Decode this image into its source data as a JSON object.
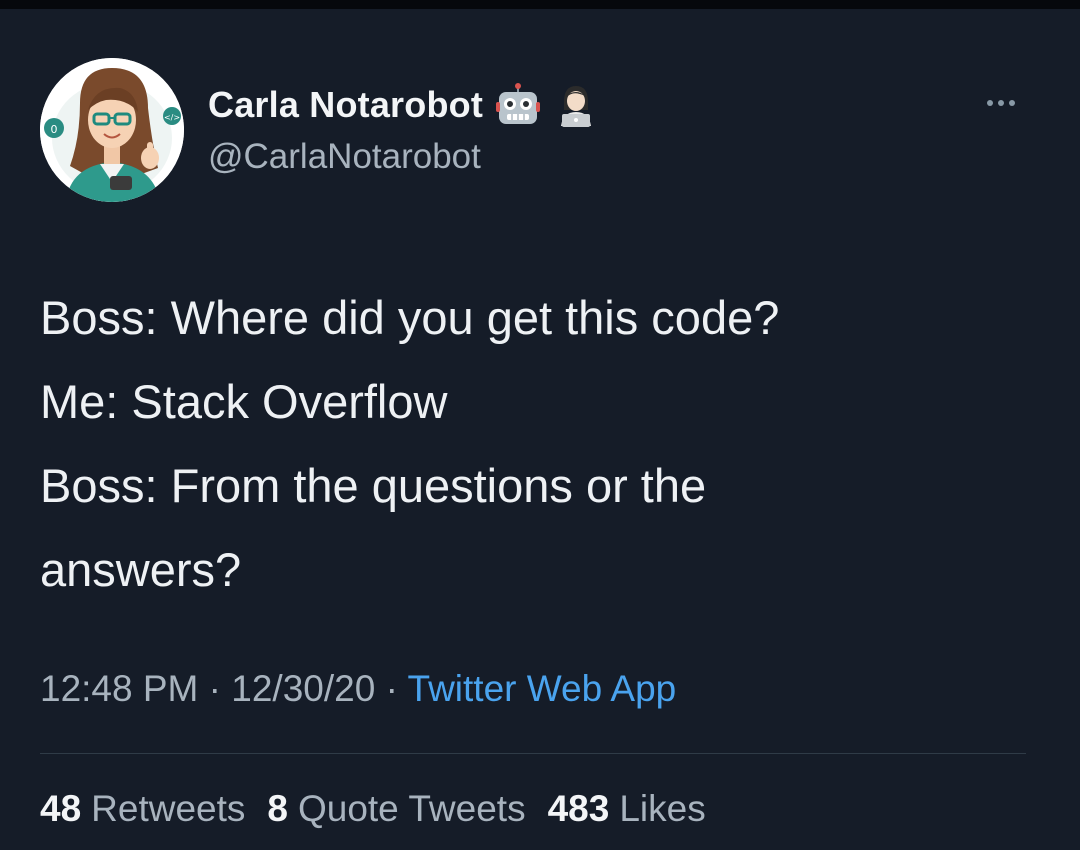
{
  "tweet": {
    "author": {
      "display_name": "Carla Notarobot",
      "handle": "@CarlaNotarobot",
      "name_emojis": [
        "robot-face-icon",
        "woman-technologist-icon"
      ]
    },
    "text_lines": [
      "Boss: Where did you get this code?",
      "Me: Stack Overflow",
      "Boss: From the questions or the",
      "answers?"
    ],
    "time": "12:48 PM",
    "date": "12/30/20",
    "separator": "·",
    "source": "Twitter Web App",
    "stats": {
      "retweets": {
        "count": "48",
        "label": "Retweets"
      },
      "quote_tweets": {
        "count": "8",
        "label": "Quote Tweets"
      },
      "likes": {
        "count": "483",
        "label": "Likes"
      }
    }
  },
  "colors": {
    "background": "#151c28",
    "text_primary": "#eef1f4",
    "text_secondary": "#a8b3be",
    "link": "#4aa3ee",
    "divider": "#2f3b47"
  }
}
